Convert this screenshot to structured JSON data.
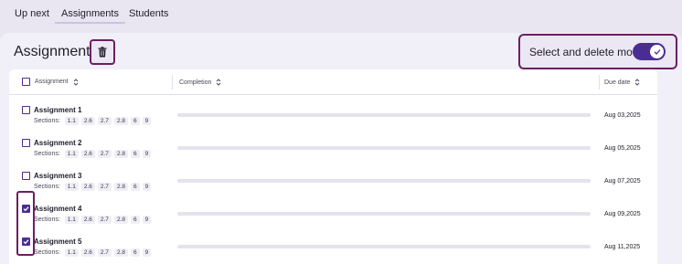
{
  "tabs": [
    {
      "label": "Up next",
      "active": false
    },
    {
      "label": "Assignments",
      "active": true
    },
    {
      "label": "Students",
      "active": false
    }
  ],
  "header": {
    "title": "Assignments",
    "trash_icon": "trash-icon",
    "mode_label": "Select and delete mode",
    "mode_enabled": true
  },
  "table": {
    "columns": {
      "assignment": "Assignment",
      "completion": "Completion",
      "due_date": "Due date"
    },
    "sections_label": "Sections:",
    "rows": [
      {
        "name": "Assignment 1",
        "sections": [
          "1.1",
          "2.6",
          "2.7",
          "2.8",
          "6",
          "9"
        ],
        "due": "Aug 03,2025",
        "checked": false,
        "completion": 0
      },
      {
        "name": "Assignment 2",
        "sections": [
          "1.1",
          "2.6",
          "2.7",
          "2.8",
          "6",
          "9"
        ],
        "due": "Aug 05,2025",
        "checked": false,
        "completion": 0
      },
      {
        "name": "Assignment 3",
        "sections": [
          "1.1",
          "2.6",
          "2.7",
          "2.8",
          "6",
          "9"
        ],
        "due": "Aug 07,2025",
        "checked": false,
        "completion": 0
      },
      {
        "name": "Assignment 4",
        "sections": [
          "1.1",
          "2.6",
          "2.7",
          "2.8",
          "6",
          "9"
        ],
        "due": "Aug 09,2025",
        "checked": true,
        "completion": 0
      },
      {
        "name": "Assignment 5",
        "sections": [
          "1.1",
          "2.6",
          "2.7",
          "2.8",
          "6",
          "9"
        ],
        "due": "Aug 11,2025",
        "checked": true,
        "completion": 0
      }
    ]
  },
  "colors": {
    "accent": "#4a2d93",
    "highlight": "#6b1f63"
  }
}
